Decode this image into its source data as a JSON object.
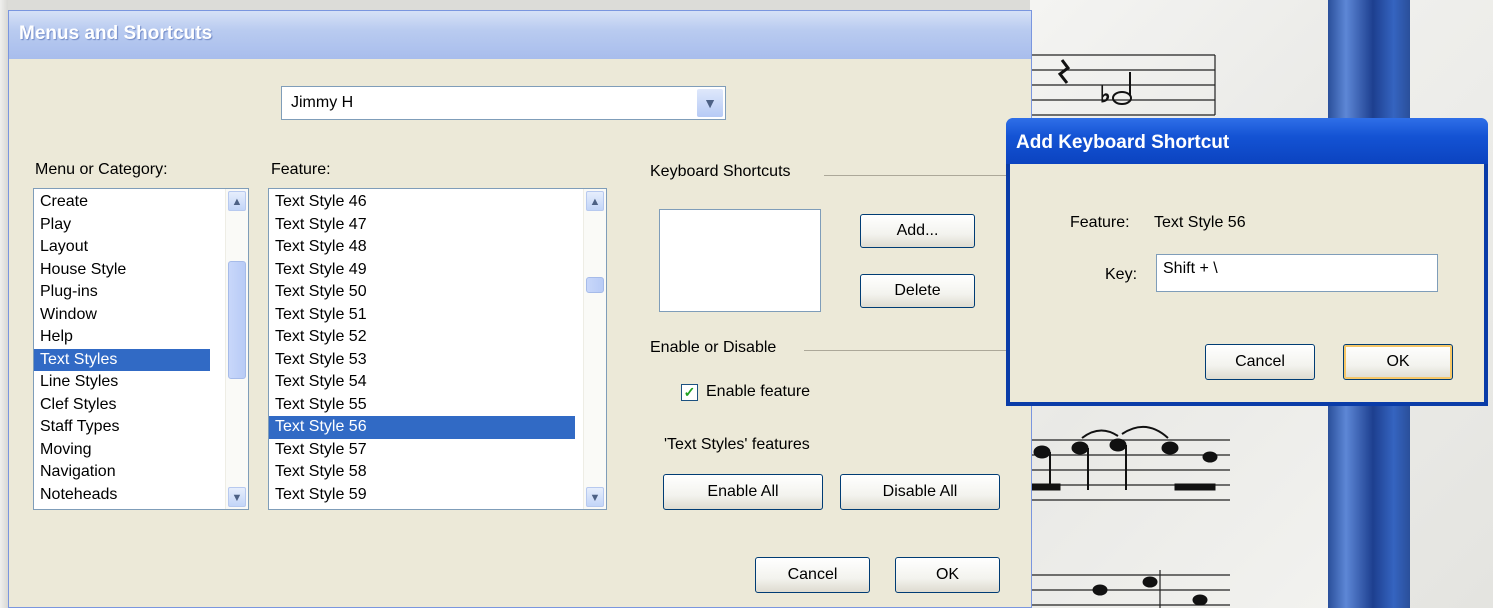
{
  "main_dialog": {
    "title": "Menus and Shortcuts",
    "menu_set": "Jimmy H",
    "menu_label": "Menu or Category:",
    "feature_label": "Feature:",
    "categories": [
      "Create",
      "Play",
      "Layout",
      "House Style",
      "Plug-ins",
      "Window",
      "Help",
      "Text Styles",
      "Line Styles",
      "Clef Styles",
      "Staff Types",
      "Moving",
      "Navigation",
      "Noteheads"
    ],
    "selected_category": "Text Styles",
    "features": [
      "Text Style 46",
      "Text Style 47",
      "Text Style 48",
      "Text Style 49",
      "Text Style 50",
      "Text Style 51",
      "Text Style 52",
      "Text Style 53",
      "Text Style 54",
      "Text Style 55",
      "Text Style 56",
      "Text Style 57",
      "Text Style 58",
      "Text Style 59"
    ],
    "selected_feature": "Text Style 56",
    "keyboard_shortcuts_label": "Keyboard Shortcuts",
    "add_label": "Add...",
    "delete_label": "Delete",
    "enable_disable_label": "Enable or Disable",
    "enable_feature_label": "Enable feature",
    "enable_feature_checked": true,
    "features_group_label": "'Text Styles' features",
    "enable_all_label": "Enable All",
    "disable_all_label": "Disable All",
    "cancel_label": "Cancel",
    "ok_label": "OK"
  },
  "shortcut_dialog": {
    "title": "Add Keyboard Shortcut",
    "feature_label": "Feature:",
    "feature_value": "Text Style 56",
    "key_label": "Key:",
    "key_value": "Shift + \\",
    "cancel_label": "Cancel",
    "ok_label": "OK"
  },
  "colors": {
    "selection": "#316ac5",
    "dialog_bg": "#ece9d8",
    "title_active": "#0b43c0"
  },
  "icons": [
    "chevron-down-icon",
    "scroll-up-icon",
    "scroll-down-icon",
    "checkmark-icon"
  ]
}
